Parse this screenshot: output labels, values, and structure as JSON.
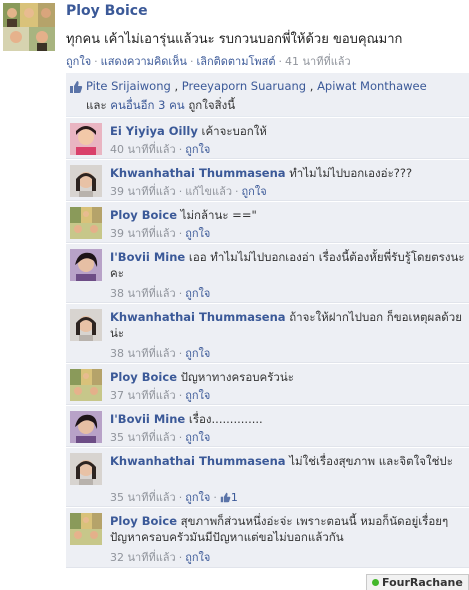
{
  "post": {
    "author": "Ploy Boice",
    "text": "ทุกคน เค้าไม่เอารุ่นแล้วนะ รบกวนบอกพี่ให้ด้วย ขอบคุณมาก",
    "actions": {
      "like": "ถูกใจ",
      "comment": "แสดงความคิดเห็น",
      "unfollow": "เลิกติดตามโพสต์",
      "time": "41 นาทีที่แล้ว"
    }
  },
  "likes": {
    "names": [
      "Pite Srijaiwong",
      "Preeyaporn Suaruang",
      "Apiwat Monthawee"
    ],
    "and": "และ",
    "others": "คนอื่นอีก 3 คน",
    "suffix": "ถูกใจสิ่งนี้"
  },
  "comments": [
    {
      "name": "Ei Yiyiya Oilly",
      "text": "เค้าจะบอกให้",
      "time": "40 นาทีที่แล้ว",
      "like": "ถูกใจ"
    },
    {
      "name": "Khwanhathai Thummasena",
      "text": "ทำไมไม่ไปบอกเองอ่ะ???",
      "time": "39 นาทีที่แล้ว",
      "edited": "แก้ไขแล้ว",
      "like": "ถูกใจ"
    },
    {
      "name": "Ploy Boice",
      "text": "ไม่กล้านะ ==\"",
      "time": "39 นาทีที่แล้ว",
      "like": "ถูกใจ"
    },
    {
      "name": "I'Bovii Mine",
      "text": "เออ ทำไมไม่ไปบอกเองอ่า เรื่องนี้ต้องหั้ยพี่รับรู้โดยตรงนะคะ",
      "time": "38 นาทีที่แล้ว",
      "like": "ถูกใจ"
    },
    {
      "name": "Khwanhathai Thummasena",
      "text": "ถ้าจะให้ฝากไปบอก ก็ขอเหตุผลด้วยน่ะ",
      "time": "38 นาทีที่แล้ว",
      "like": "ถูกใจ"
    },
    {
      "name": "Ploy Boice",
      "text": "ปัญหาทางครอบครัวน่ะ",
      "time": "37 นาทีที่แล้ว",
      "like": "ถูกใจ"
    },
    {
      "name": "I'Bovii Mine",
      "text": "เรื่อง..............",
      "time": "35 นาทีที่แล้ว",
      "like": "ถูกใจ"
    },
    {
      "name": "Khwanhathai Thummasena",
      "text": "ไม่ใช่เรื่องสุขภาพ และจิตใจใช่ปะ",
      "time": "35 นาทีที่แล้ว",
      "like": "ถูกใจ",
      "like_count": "1"
    },
    {
      "name": "Ploy Boice",
      "text": "สุขภาพก็ส่วนหนึ่งอ่ะจ่ะ เพราะตอนนี้ หมอก็นัดอยู่เรื่อยๆ ปัญหาครอบครัวมันมีปัญหาแต่ขอไม่บอกแล้วกัน",
      "time": "32 นาทีที่แล้ว",
      "like": "ถูกใจ"
    }
  ],
  "chat": {
    "name": "FourRachane"
  },
  "colors": {
    "link": "#3b5998",
    "ufi_bg": "#edeff4",
    "online": "#42b72a"
  }
}
